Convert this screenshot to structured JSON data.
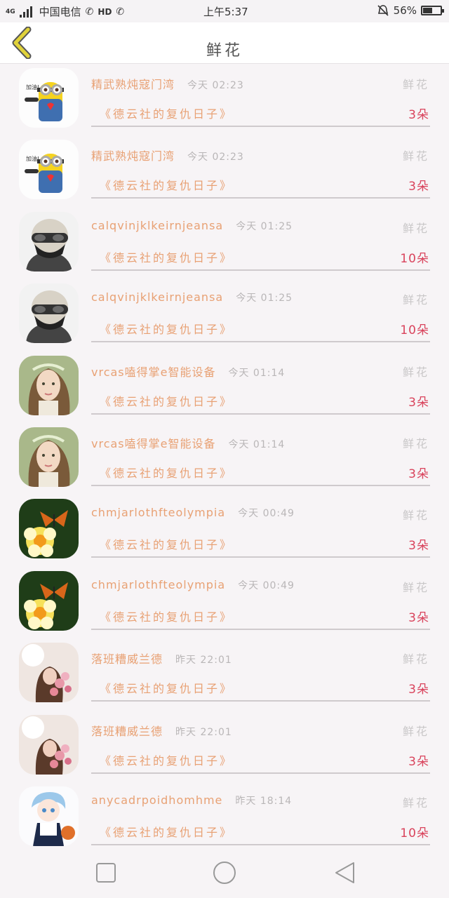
{
  "status_bar": {
    "network": "4G",
    "carrier": "中国电信",
    "hd": "HD",
    "time": "上午5:37",
    "battery_text": "56%",
    "battery_level": 0.56
  },
  "header": {
    "title": "鲜花",
    "back_icon": "chevron-left-icon",
    "accent": "#e0d23a"
  },
  "colors": {
    "name": "#e8a174",
    "count": "#d9435c",
    "muted": "#c9c7c8"
  },
  "items": [
    {
      "name": "精武熟炖寇门湾",
      "time": "今天 02:23",
      "gift": "鲜花",
      "book": "《德云社的复仇日子》",
      "count": "3朵",
      "avatar": "minion"
    },
    {
      "name": "精武熟炖寇门湾",
      "time": "今天 02:23",
      "gift": "鲜花",
      "book": "《德云社的复仇日子》",
      "count": "3朵",
      "avatar": "minion"
    },
    {
      "name": "calqvinjklkeirnjeansa",
      "time": "今天 01:25",
      "gift": "鲜花",
      "book": "《德云社的复仇日子》",
      "count": "10朵",
      "avatar": "soldier"
    },
    {
      "name": "calqvinjklkeirnjeansa",
      "time": "今天 01:25",
      "gift": "鲜花",
      "book": "《德云社的复仇日子》",
      "count": "10朵",
      "avatar": "soldier"
    },
    {
      "name": "vrcas嗑得掌e智能设备",
      "time": "今天 01:14",
      "gift": "鲜花",
      "book": "《德云社的复仇日子》",
      "count": "3朵",
      "avatar": "girl"
    },
    {
      "name": "vrcas嗑得掌e智能设备",
      "time": "今天 01:14",
      "gift": "鲜花",
      "book": "《德云社的复仇日子》",
      "count": "3朵",
      "avatar": "girl"
    },
    {
      "name": "chmjarlothfteolympia",
      "time": "今天 00:49",
      "gift": "鲜花",
      "book": "《德云社的复仇日子》",
      "count": "3朵",
      "avatar": "butterfly"
    },
    {
      "name": "chmjarlothfteolympia",
      "time": "今天 00:49",
      "gift": "鲜花",
      "book": "《德云社的复仇日子》",
      "count": "3朵",
      "avatar": "butterfly"
    },
    {
      "name": "落班糟威兰德",
      "time": "昨天 22:01",
      "gift": "鲜花",
      "book": "《德云社的复仇日子》",
      "count": "3朵",
      "avatar": "flowers-girl"
    },
    {
      "name": "落班糟威兰德",
      "time": "昨天 22:01",
      "gift": "鲜花",
      "book": "《德云社的复仇日子》",
      "count": "3朵",
      "avatar": "flowers-girl"
    },
    {
      "name": "anycadrpoidhomhme",
      "time": "昨天 18:14",
      "gift": "鲜花",
      "book": "《德云社的复仇日子》",
      "count": "10朵",
      "avatar": "anime-boy"
    }
  ],
  "nav": {
    "recent": "square-icon",
    "home": "circle-icon",
    "back": "triangle-back-icon"
  }
}
